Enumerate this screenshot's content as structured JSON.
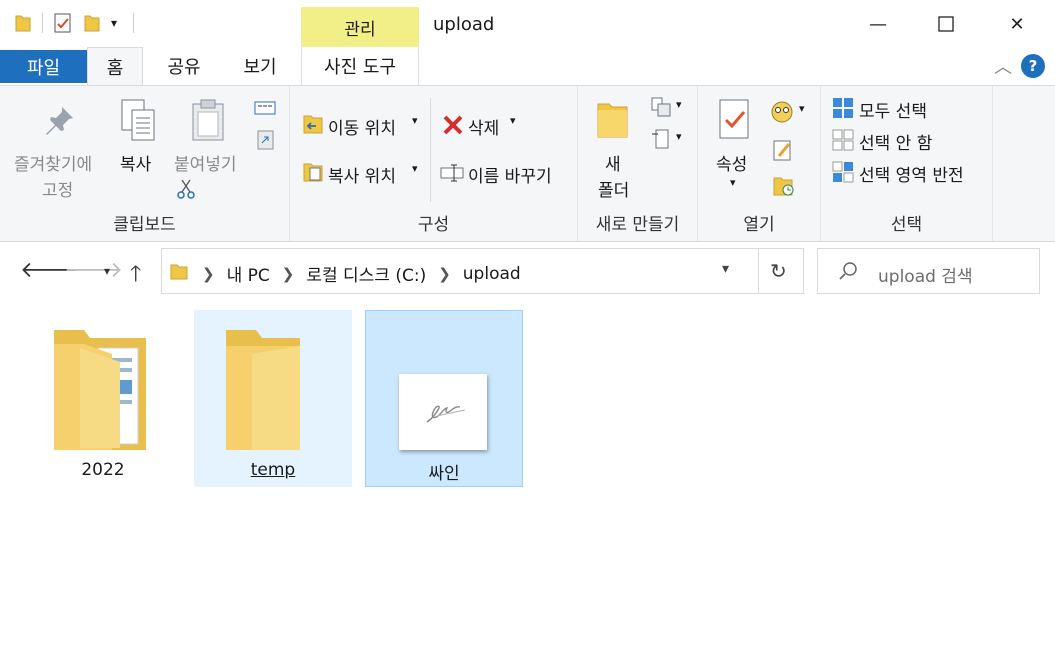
{
  "titlebar": {
    "title": "upload",
    "context_tab": "관리",
    "min_symbol": "—",
    "max_symbol": "☐",
    "close_symbol": "✕"
  },
  "tabs": {
    "file": "파일",
    "home": "홈",
    "share": "공유",
    "view": "보기",
    "phototool": "사진 도구"
  },
  "ribbon": {
    "clipboard": {
      "label": "클립보드",
      "pin_line1": "즐겨찾기에",
      "pin_line2": "고정",
      "copy": "복사",
      "paste": "붙여넣기"
    },
    "organize": {
      "label": "구성",
      "move_to": "이동 위치",
      "copy_to": "복사 위치",
      "delete": "삭제",
      "rename": "이름 바꾸기"
    },
    "new": {
      "label": "새로 만들기",
      "new_folder_line1": "새",
      "new_folder_line2": "폴더"
    },
    "open": {
      "label": "열기",
      "properties": "속성"
    },
    "select": {
      "label": "선택",
      "select_all": "모두 선택",
      "select_none": "선택 안 함",
      "invert": "선택 영역 반전"
    }
  },
  "address": {
    "crumbs": [
      "내 PC",
      "로컬 디스크 (C:)",
      "upload"
    ],
    "search_placeholder": "upload 검색"
  },
  "files": [
    {
      "name": "2022",
      "type": "folder-with-docs"
    },
    {
      "name": "temp",
      "type": "folder"
    },
    {
      "name": "싸인",
      "type": "image"
    }
  ],
  "colors": {
    "accent": "#1f6fbf",
    "context_tab": "#f3ef88",
    "selection": "#cce8ff"
  }
}
